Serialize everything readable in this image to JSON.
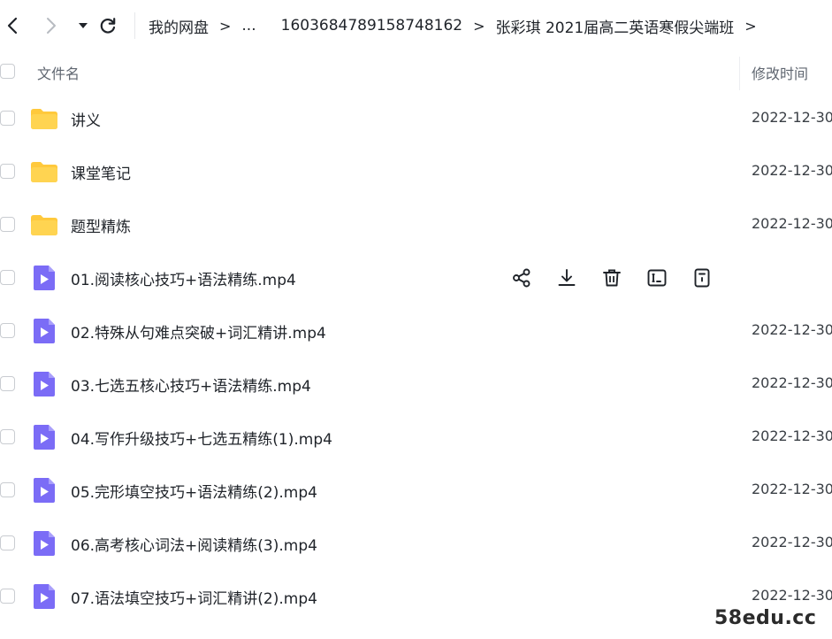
{
  "nav": {
    "back_icon": "chevron-left-icon",
    "forward_icon": "chevron-right-icon",
    "dropdown_icon": "caret-down-icon",
    "refresh_icon": "refresh-icon"
  },
  "breadcrumb": {
    "items": [
      "我的网盘",
      "...",
      "1603684789158748162",
      "张彩琪 2021届高二英语寒假尖端班"
    ],
    "separator": ">"
  },
  "header": {
    "name_label": "文件名",
    "time_label": "修改时间"
  },
  "files": [
    {
      "name": "讲义",
      "type": "folder",
      "modified": "2022-12-30"
    },
    {
      "name": "课堂笔记",
      "type": "folder",
      "modified": "2022-12-30"
    },
    {
      "name": "题型精炼",
      "type": "folder",
      "modified": "2022-12-30"
    },
    {
      "name": "01.阅读核心技巧+语法精练.mp4",
      "type": "video",
      "modified": ""
    },
    {
      "name": "02.特殊从句难点突破+词汇精讲.mp4",
      "type": "video",
      "modified": "2022-12-30"
    },
    {
      "name": "03.七选五核心技巧+语法精练.mp4",
      "type": "video",
      "modified": "2022-12-30"
    },
    {
      "name": "04.写作升级技巧+七选五精练(1).mp4",
      "type": "video",
      "modified": "2022-12-30"
    },
    {
      "name": "05.完形填空技巧+语法精练(2).mp4",
      "type": "video",
      "modified": "2022-12-30"
    },
    {
      "name": "06.高考核心词法+阅读精练(3).mp4",
      "type": "video",
      "modified": "2022-12-30"
    },
    {
      "name": "07.语法填空技巧+词汇精讲(2).mp4",
      "type": "video",
      "modified": "2022-12-30"
    }
  ],
  "row_actions": [
    "share-icon",
    "download-icon",
    "delete-icon",
    "rename-icon",
    "more-icon"
  ],
  "colors": {
    "folder": "#ffc93c",
    "video": "#7b6cf6",
    "text": "#1f2329",
    "muted": "#5f6670"
  },
  "watermark": "58edu.cc"
}
